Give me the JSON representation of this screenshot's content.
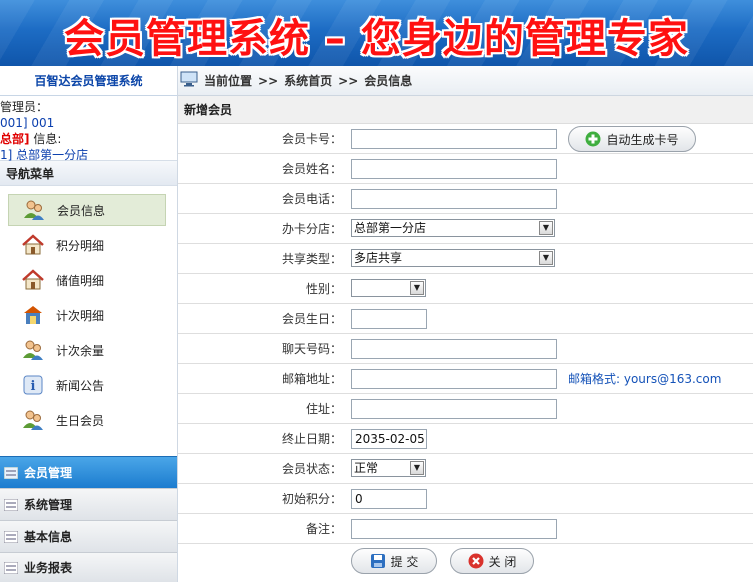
{
  "banner": {
    "title": "会员管理系统 – 您身边的管理专家"
  },
  "sidebar": {
    "system_name": "百智达会员管理系统",
    "user": {
      "admin_label": "管理员：",
      "admin_value": "001] 001",
      "store_tag": "总部]",
      "info_label": " 信息:",
      "store_value": "1] 总部第一分店"
    },
    "nav_title": "导航菜单",
    "menu_items": [
      {
        "label": "会员信息",
        "icon": "member-icon"
      },
      {
        "label": "积分明细",
        "icon": "house-icon"
      },
      {
        "label": "储值明细",
        "icon": "house-icon"
      },
      {
        "label": "计次明细",
        "icon": "shop-icon"
      },
      {
        "label": "计次余量",
        "icon": "member-icon"
      },
      {
        "label": "新闻公告",
        "icon": "info-icon"
      },
      {
        "label": "生日会员",
        "icon": "member-icon"
      }
    ],
    "accordion": [
      {
        "label": "会员管理"
      },
      {
        "label": "系统管理"
      },
      {
        "label": "基本信息"
      },
      {
        "label": "业务报表"
      }
    ]
  },
  "breadcrumb": {
    "current": "当前位置",
    "sep1": ">>",
    "home": "系统首页",
    "sep2": ">>",
    "page": "会员信息"
  },
  "form": {
    "title": "新增会员",
    "card_no": {
      "label": "会员卡号：",
      "value": ""
    },
    "generate_button": "自动生成卡号",
    "name": {
      "label": "会员姓名：",
      "value": ""
    },
    "phone": {
      "label": "会员电话：",
      "value": ""
    },
    "branch": {
      "label": "办卡分店：",
      "value": "总部第一分店"
    },
    "share_type": {
      "label": "共享类型：",
      "value": "多店共享"
    },
    "gender": {
      "label": "性别：",
      "value": ""
    },
    "birthday": {
      "label": "会员生日：",
      "value": ""
    },
    "chat": {
      "label": "聊天号码：",
      "value": ""
    },
    "email": {
      "label": "邮箱地址：",
      "value": "",
      "hint": "邮箱格式: yours@163.com"
    },
    "address": {
      "label": "住址：",
      "value": ""
    },
    "end_date": {
      "label": "终止日期：",
      "value": "2035-02-05"
    },
    "status": {
      "label": "会员状态：",
      "value": "正常"
    },
    "points": {
      "label": "初始积分：",
      "value": "0"
    },
    "remark": {
      "label": "备注：",
      "value": ""
    },
    "submit_button": "提 交",
    "close_button": "关 闭"
  }
}
